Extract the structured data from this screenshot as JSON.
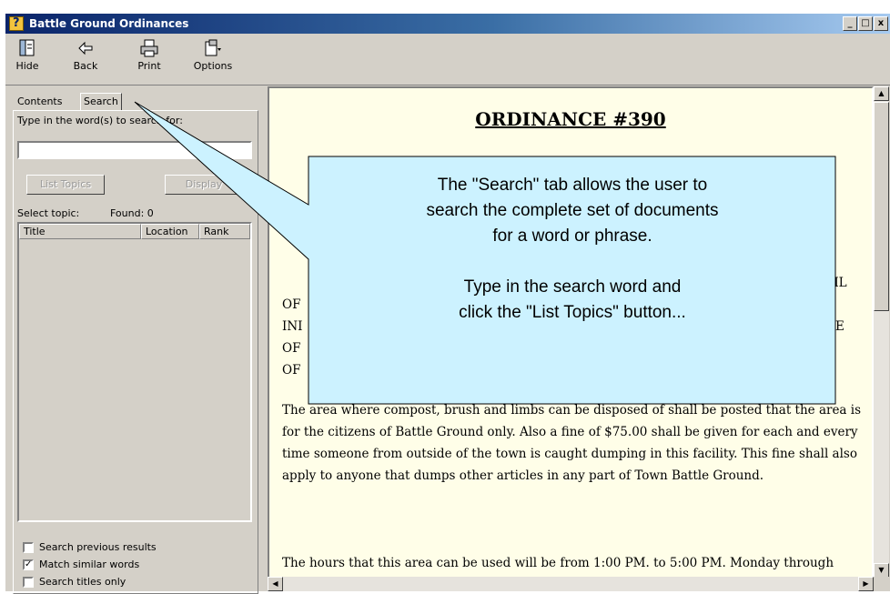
{
  "window": {
    "title": "Battle Ground Ordinances",
    "controls": {
      "minimize": "_",
      "maximize": "□",
      "close": "x"
    }
  },
  "toolbar": {
    "hide": "Hide",
    "back": "Back",
    "print": "Print",
    "options": "Options"
  },
  "tabs": {
    "contents": "Contents",
    "search": "Search"
  },
  "search": {
    "prompt": "Type in the word(s) to search for:",
    "input_value": "",
    "list_topics": "List Topics",
    "display": "Display",
    "select_topic": "Select topic:",
    "found": "Found: 0",
    "columns": [
      "Title",
      "Location",
      "Rank"
    ],
    "options": [
      {
        "label": "Search previous results",
        "checked": false
      },
      {
        "label": "Match similar words",
        "checked": true
      },
      {
        "label": "Search titles only",
        "checked": false
      }
    ]
  },
  "document": {
    "title": "ORDINANCE #390",
    "fragments": [
      "CIL",
      "OF",
      "INI",
      "E",
      "OF",
      "OF"
    ],
    "paragraph1": "The area where compost, brush and limbs can be disposed of shall be posted that the area is for the citizens of Battle Ground only. Also a fine of $75.00 shall be given for each and every time someone from outside of the town is caught dumping in this facility. This fine shall also apply to anyone that dumps other articles in any part of Town Battle Ground.",
    "paragraph2": "The hours that this area can be used will be from 1:00 PM. to 5:00 PM. Monday through Saturday. However we will allow other hours upon appointment only."
  },
  "callout": {
    "line1": "The \"Search\" tab allows the user to",
    "line2": "search the complete set of documents",
    "line3": "for a word or phrase.",
    "line4": "Type in the search word and",
    "line5": "click the \"List Topics\" button..."
  },
  "colors": {
    "titlebar_start": "#0a246a",
    "titlebar_end": "#a6caf0",
    "window_face": "#d4d0c8",
    "document_bg": "#fffee8",
    "callout_fill": "#ccf2ff"
  }
}
